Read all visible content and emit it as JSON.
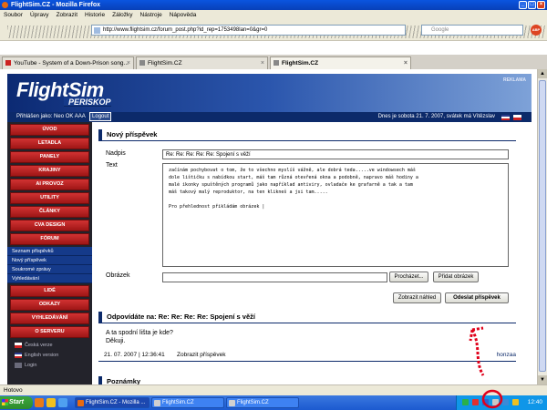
{
  "window": {
    "title": "FlightSim.CZ - Mozilla Firefox"
  },
  "menubar": [
    "Soubor",
    "Úpravy",
    "Zobrazit",
    "Historie",
    "Záložky",
    "Nástroje",
    "Nápověda"
  ],
  "nav": {
    "url": "http://www.flightsim.cz/forum_post.php?id_rep=1753498lan=0&gr=0",
    "search_placeholder": "Google",
    "abp": "ABP"
  },
  "tabs": [
    {
      "label": "YouTube - System of a Down-Prison song..."
    },
    {
      "label": "FlightSim.CZ"
    },
    {
      "label": "FlightSim.CZ"
    }
  ],
  "site": {
    "logo": "FlightSim",
    "logo_sub": "PERISKOP",
    "reklama": "REKLAMA",
    "login_text": "Přihlášen jako: Neo OK AAA",
    "logout": "Logout",
    "date_text": "Dnes je sobota 21. 7. 2007, svátek má Vítězslav"
  },
  "sidebar": {
    "menu": [
      "ÚVOD",
      "LETADLA",
      "PANELY",
      "KRAJINY",
      "AI PROVOZ",
      "UTILITY",
      "ČLÁNKY",
      "CVA DESIGN",
      "FÓRUM"
    ],
    "forum_sub": [
      "Seznam příspěvků",
      "Nový příspěvek",
      "Soukromé zprávy",
      "Vyhledávání"
    ],
    "menu2": [
      "LIDÉ",
      "ODKAZY",
      "VYHLEDÁVÁNÍ",
      "O SERVERU"
    ],
    "langs": [
      "Česká verze",
      "English version",
      "Login"
    ]
  },
  "form": {
    "title": "Nový příspěvek",
    "subject_label": "Nadpis",
    "subject_value": "Re: Re: Re: Re: Re: Spojení s věží",
    "text_label": "Text",
    "text_value": "začínám pochybovat o tom, že to všechno myslíš vážně, ale dobrá teda.....ve windowsech máš\ndole lištičku s nabídkou start, máš tam různá otevřená okna a podobně, napravo máš hodiny a\nmalé ikonky spuštěných programů jako například antiviry, ovladače ke grafarně a tak a tam\nmáš takový malý reproduktor, na ten klikneš a jsi tam.....\n\nPro přehlednost přikládám obrázek |",
    "image_label": "Obrázek",
    "browse": "Procházet...",
    "add_image": "Přidat obrázek",
    "preview": "Zobrazit náhled",
    "send": "Odeslat příspěvek"
  },
  "reply": {
    "title": "Odpovídáte na: Re: Re: Re: Re: Spojení s věží",
    "line1": "A ta spodní lišta je kde?",
    "line2": "Děkuji.",
    "datetime": "21. 07. 2007 | 12:36:41",
    "show": "Zobrazit příspěvek",
    "author": "honzaa"
  },
  "next_section": "Poznámky",
  "statusbar": "Hotovo",
  "taskbar": {
    "start": "Start",
    "items": [
      "FlightSim.CZ - Mozilla ...",
      "FlightSim.CZ",
      "FlightSim.CZ"
    ],
    "clock": "12:40"
  },
  "colors": {
    "nav_red": "#c12222",
    "site_blue": "#0c2a6a",
    "xp_blue": "#245edc",
    "annotation_red": "#e0001a"
  }
}
